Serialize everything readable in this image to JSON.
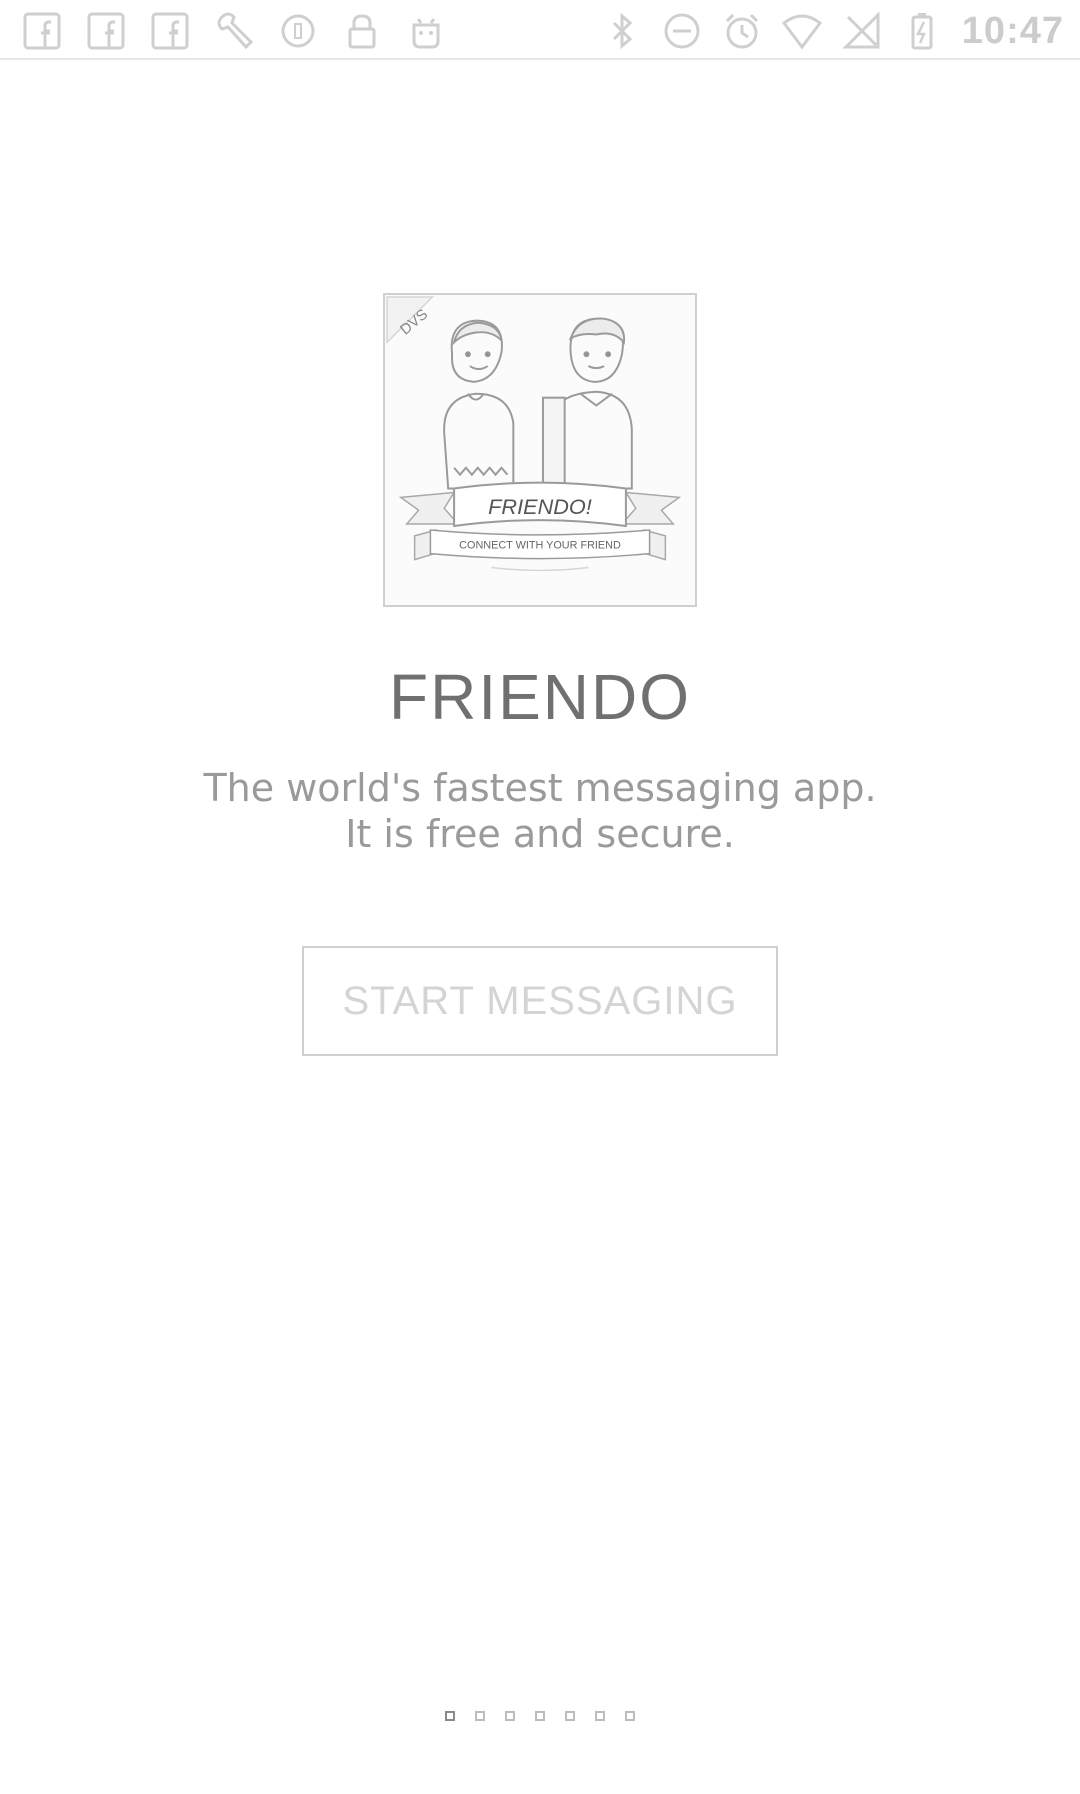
{
  "status_bar": {
    "time": "10:47",
    "left_icons": [
      "facebook-icon",
      "facebook-icon",
      "facebook-icon",
      "wrench-icon",
      "record-icon",
      "lock-icon",
      "android-icon"
    ],
    "right_icons": [
      "bluetooth-icon",
      "do-not-disturb-icon",
      "alarm-icon",
      "wifi-icon",
      "no-signal-icon",
      "battery-charging-icon"
    ]
  },
  "logo": {
    "badge": "DVS",
    "banner_title": "FRIENDO!",
    "banner_subtitle": "CONNECT WITH YOUR FRIEND"
  },
  "app": {
    "title": "FRIENDO",
    "tagline_line1": "The world's fastest messaging app.",
    "tagline_line2": "It is free and secure."
  },
  "actions": {
    "start_label": "START MESSAGING"
  },
  "pager": {
    "count": 7,
    "active_index": 0
  },
  "colors": {
    "background": "#ffffff",
    "title": "#707070",
    "tagline": "#9a9a9a",
    "button_text": "#d4d4d4"
  }
}
